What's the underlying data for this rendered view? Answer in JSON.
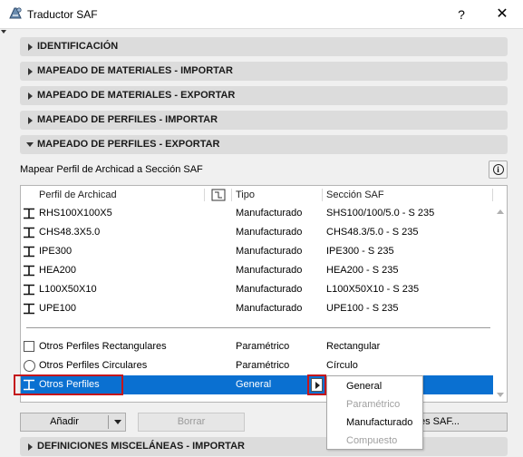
{
  "window": {
    "title": "Traductor SAF",
    "help": "?",
    "close": "✕"
  },
  "sections": [
    {
      "label": "IDENTIFICACIÓN",
      "expanded": false
    },
    {
      "label": "MAPEADO DE MATERIALES - IMPORTAR",
      "expanded": false
    },
    {
      "label": "MAPEADO DE MATERIALES - EXPORTAR",
      "expanded": false
    },
    {
      "label": "MAPEADO DE PERFILES - IMPORTAR",
      "expanded": false
    },
    {
      "label": "MAPEADO DE PERFILES - EXPORTAR",
      "expanded": true
    },
    {
      "label": "DEFINICIONES MISCELÁNEAS - IMPORTAR",
      "expanded": false
    }
  ],
  "mapping": {
    "label": "Mapear Perfil de Archicad a Sección SAF",
    "info_icon": "i",
    "columns": [
      "Perfil de Archicad",
      "Tipo",
      "Sección SAF"
    ],
    "rows": [
      {
        "profile": "RHS100X100X5",
        "type": "Manufacturado",
        "section": "SHS100/100/5.0 - S 235"
      },
      {
        "profile": "CHS48.3X5.0",
        "type": "Manufacturado",
        "section": "CHS48.3/5.0 - S 235"
      },
      {
        "profile": "IPE300",
        "type": "Manufacturado",
        "section": "IPE300 - S 235"
      },
      {
        "profile": "HEA200",
        "type": "Manufacturado",
        "section": "HEA200 - S 235"
      },
      {
        "profile": "L100X50X10",
        "type": "Manufacturado",
        "section": "L100X50X10 - S 235"
      },
      {
        "profile": "UPE100",
        "type": "Manufacturado",
        "section": "UPE100 - S 235"
      }
    ],
    "other_rows": [
      {
        "profile": "Otros Perfiles Rectangulares",
        "type": "Paramétrico",
        "section": "Rectangular"
      },
      {
        "profile": "Otros Perfiles Circulares",
        "type": "Paramétrico",
        "section": "Círculo"
      },
      {
        "profile": "Otros Perfiles",
        "type": "General",
        "section": ""
      }
    ]
  },
  "buttons": {
    "add": "Añadir",
    "delete": "Borrar",
    "saf": "es SAF..."
  },
  "type_menu": {
    "items": [
      {
        "label": "General",
        "enabled": true
      },
      {
        "label": "Paramétrico",
        "enabled": false
      },
      {
        "label": "Manufacturado",
        "enabled": true
      },
      {
        "label": "Compuesto",
        "enabled": false
      }
    ]
  },
  "colors": {
    "selection": "#0a70d1",
    "highlight_box": "#c4161c",
    "section_header": "#dcdcdc"
  }
}
